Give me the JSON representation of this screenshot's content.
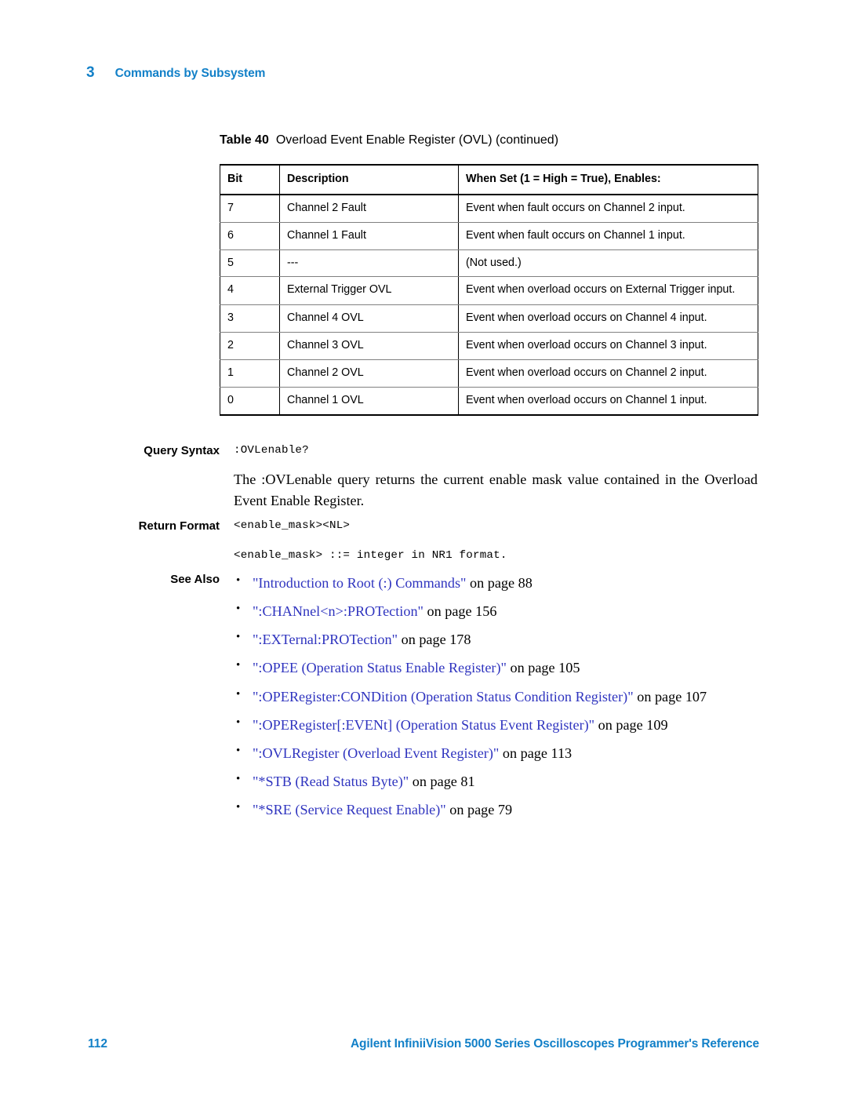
{
  "header": {
    "chapter_number": "3",
    "chapter_title": "Commands by Subsystem"
  },
  "table": {
    "caption_label": "Table 40",
    "caption_text": "Overload Event Enable Register (OVL) (continued)",
    "columns": [
      "Bit",
      "Description",
      "When Set (1 = High = True), Enables:"
    ],
    "rows": [
      [
        "7",
        "Channel 2 Fault",
        "Event when fault occurs on Channel 2 input."
      ],
      [
        "6",
        "Channel 1 Fault",
        "Event when fault occurs on Channel 1 input."
      ],
      [
        "5",
        "---",
        "(Not used.)"
      ],
      [
        "4",
        "External Trigger OVL",
        "Event when overload occurs on External Trigger input."
      ],
      [
        "3",
        "Channel 4 OVL",
        "Event when overload occurs on Channel 4 input."
      ],
      [
        "2",
        "Channel 3 OVL",
        "Event when overload occurs on Channel 3 input."
      ],
      [
        "1",
        "Channel 2 OVL",
        "Event when overload occurs on Channel 2 input."
      ],
      [
        "0",
        "Channel 1 OVL",
        "Event when overload occurs on Channel 1 input."
      ]
    ]
  },
  "query_syntax": {
    "label": "Query Syntax",
    "code": ":OVLenable?",
    "description": "The :OVLenable query returns the current enable mask value contained in the Overload Event Enable Register."
  },
  "return_format": {
    "label": "Return Format",
    "code_line1": "<enable_mask><NL>",
    "code_line2": "<enable_mask> ::= integer in NR1 format."
  },
  "see_also": {
    "label": "See Also",
    "items": [
      {
        "title": "\"Introduction to Root (:) Commands\"",
        "page": "on page 88"
      },
      {
        "title": "\":CHANnel<n>:PROTection\"",
        "page": "on page 156"
      },
      {
        "title": "\":EXTernal:PROTection\"",
        "page": "on page 178"
      },
      {
        "title": "\":OPEE (Operation Status Enable Register)\"",
        "page": "on page 105"
      },
      {
        "title": "\":OPERegister:CONDition (Operation Status Condition Register)\"",
        "page": "on page 107"
      },
      {
        "title": "\":OPERegister[:EVENt] (Operation Status Event Register)\"",
        "page": "on page 109"
      },
      {
        "title": "\":OVLRegister (Overload Event Register)\"",
        "page": "on page 113"
      },
      {
        "title": "\"*STB (Read Status Byte)\"",
        "page": "on page 81"
      },
      {
        "title": "\"*SRE (Service Request Enable)\"",
        "page": "on page 79"
      }
    ]
  },
  "footer": {
    "page_number": "112",
    "document_title": "Agilent InfiniiVision 5000 Series Oscilloscopes Programmer's Reference"
  },
  "colors": {
    "brand_blue": "#1280c8",
    "link_blue": "#2f34bf",
    "rule_gray": "#808080"
  }
}
